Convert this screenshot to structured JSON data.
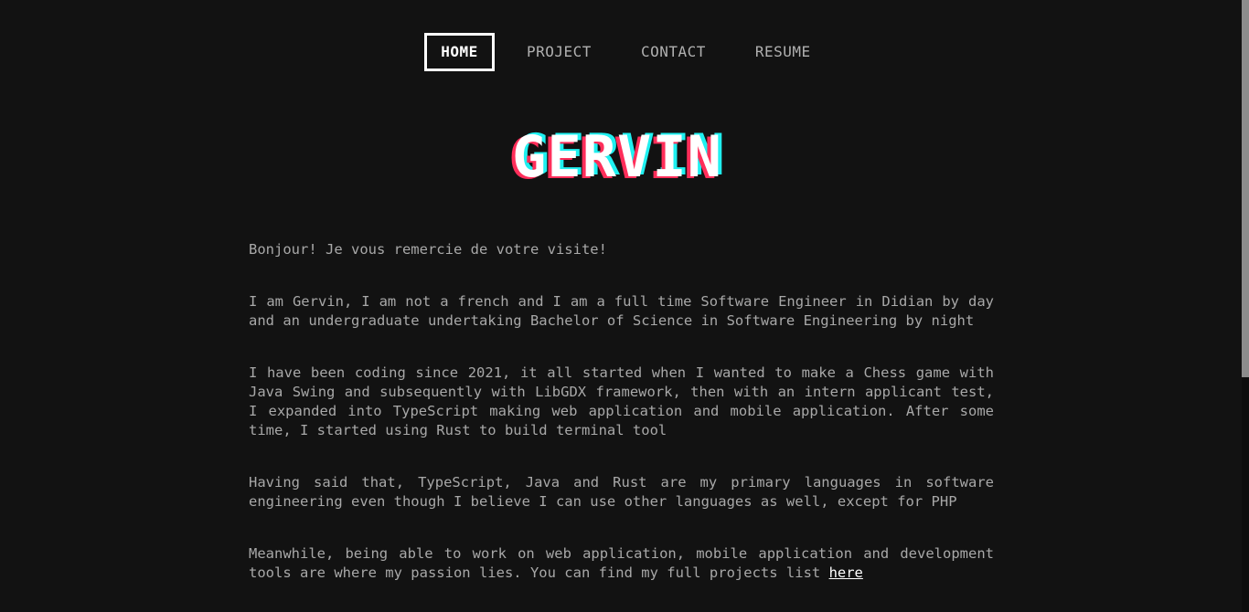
{
  "nav": {
    "items": [
      {
        "label": "HOME",
        "active": true
      },
      {
        "label": "PROJECT",
        "active": false
      },
      {
        "label": "CONTACT",
        "active": false
      },
      {
        "label": "RESUME",
        "active": false
      }
    ]
  },
  "hero": {
    "title": "GERVIN"
  },
  "content": {
    "paragraphs": [
      "Bonjour! Je vous remercie de votre visite!",
      "I am Gervin, I am not a french and I am a full time Software Engineer in Didian by day and an undergraduate undertaking Bachelor of Science in Software Engineering by night",
      "I have been coding since 2021, it all started when I wanted to make a Chess game with Java Swing and subsequently with LibGDX framework, then with an intern applicant test, I expanded into TypeScript making web application and mobile application. After some time, I started using Rust to build terminal tool",
      "Having said that, TypeScript, Java and Rust are my primary languages in software engineering even though I believe I can use other languages as well, except for PHP"
    ],
    "last_paragraph_text": "Meanwhile, being able to work on web application, mobile application and development tools are where my passion lies. You can find my full projects list ",
    "projects_link_label": "here"
  },
  "colors": {
    "background": "#121212",
    "text": "#a8a8a8",
    "accent_white": "#ffffff",
    "glitch_red": "#ff2e5a",
    "glitch_cyan": "#1ff0f0"
  }
}
